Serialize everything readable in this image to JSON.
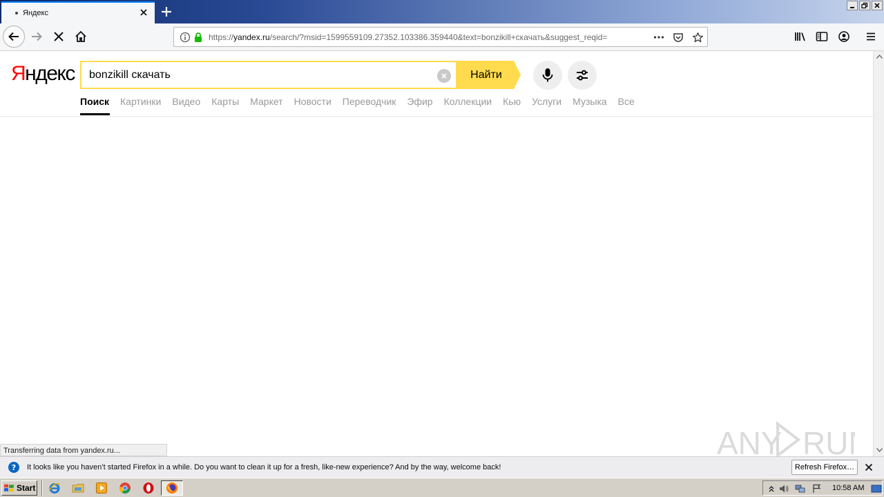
{
  "browser": {
    "tab_title": "Яндекс",
    "url_prefix": "https://",
    "url_domain": "yandex.ru",
    "url_rest": "/search/?msid=1599559109.27352.103386.359440&text=bonzikill+скачать&suggest_reqid=",
    "status_text": "Transferring data from yandex.ru...",
    "window_buttons": [
      "_",
      "▫",
      "×"
    ]
  },
  "yandex": {
    "logo_first": "Я",
    "logo_rest": "ндекс",
    "search_value": "bonzikill скачать",
    "search_button": "Найти",
    "services": [
      {
        "label": "Поиск",
        "active": true
      },
      {
        "label": "Картинки"
      },
      {
        "label": "Видео"
      },
      {
        "label": "Карты"
      },
      {
        "label": "Маркет"
      },
      {
        "label": "Новости"
      },
      {
        "label": "Переводчик"
      },
      {
        "label": "Эфир"
      },
      {
        "label": "Коллекции"
      },
      {
        "label": "Кью"
      },
      {
        "label": "Услуги"
      },
      {
        "label": "Музыка"
      },
      {
        "label": "Все"
      }
    ],
    "accent_color": "#ffdb4d"
  },
  "notification": {
    "text": "It looks like you haven’t started Firefox in a while. Do you want to clean it up for a fresh, like-new experience? And by the way, welcome back!",
    "button": "Refresh Firefox…",
    "icon": "info-icon"
  },
  "taskbar": {
    "start_label": "Start",
    "clock": "10:58 AM",
    "quick_launch": [
      "ie-icon",
      "explorer-icon",
      "media-player-icon",
      "chrome-icon",
      "opera-icon"
    ],
    "active_task": "firefox-icon"
  },
  "watermark": {
    "text": "ANY RUN"
  }
}
